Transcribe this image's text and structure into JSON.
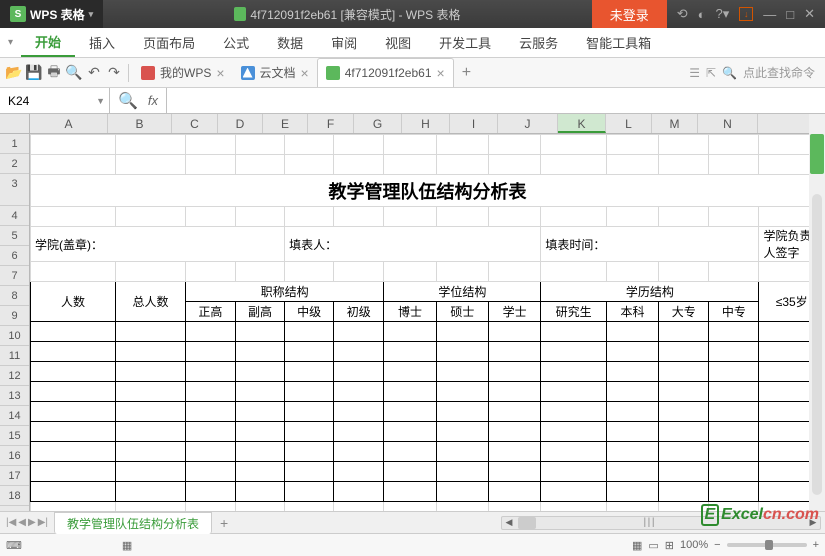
{
  "app": {
    "name": "WPS 表格",
    "doc_title": "4f712091f2eb61 [兼容模式] - WPS 表格",
    "login": "未登录"
  },
  "menu": {
    "items": [
      "开始",
      "插入",
      "页面布局",
      "公式",
      "数据",
      "审阅",
      "视图",
      "开发工具",
      "云服务",
      "智能工具箱"
    ],
    "active_index": 0
  },
  "doc_tabs": {
    "items": [
      {
        "icon": "red",
        "label": "我的WPS"
      },
      {
        "icon": "blue",
        "label": "云文档"
      },
      {
        "icon": "green",
        "label": "4f712091f2eb61"
      }
    ],
    "active_index": 2,
    "search_placeholder": "点此查找命令"
  },
  "namebox": "K24",
  "formula": "",
  "columns": [
    "A",
    "B",
    "C",
    "D",
    "E",
    "F",
    "G",
    "H",
    "I",
    "J",
    "K",
    "L",
    "M",
    "N"
  ],
  "row_count": 19,
  "chart_data": {
    "type": "table",
    "title": "教学管理队伍结构分析表",
    "meta_row": {
      "col1": "学院(盖章)：",
      "col2": "填表人：",
      "col3": "填表时间：",
      "col4": "学院负责人签字"
    },
    "header": {
      "row_label": "人数",
      "total": "总人数",
      "groups": [
        {
          "name": "职称结构",
          "subs": [
            "正高",
            "副高",
            "中级",
            "初级"
          ]
        },
        {
          "name": "学位结构",
          "subs": [
            "博士",
            "硕士",
            "学士"
          ]
        },
        {
          "name": "学历结构",
          "subs": [
            "研究生",
            "本科",
            "大专",
            "中专"
          ]
        }
      ],
      "age_col": "≤35岁"
    },
    "data_rows": 9
  },
  "sheet_tabs": {
    "active": "教学管理队伍结构分析表"
  },
  "status": {
    "zoom": "100%"
  },
  "watermark": {
    "brand": "Excel",
    "suffix": "cn.com"
  }
}
